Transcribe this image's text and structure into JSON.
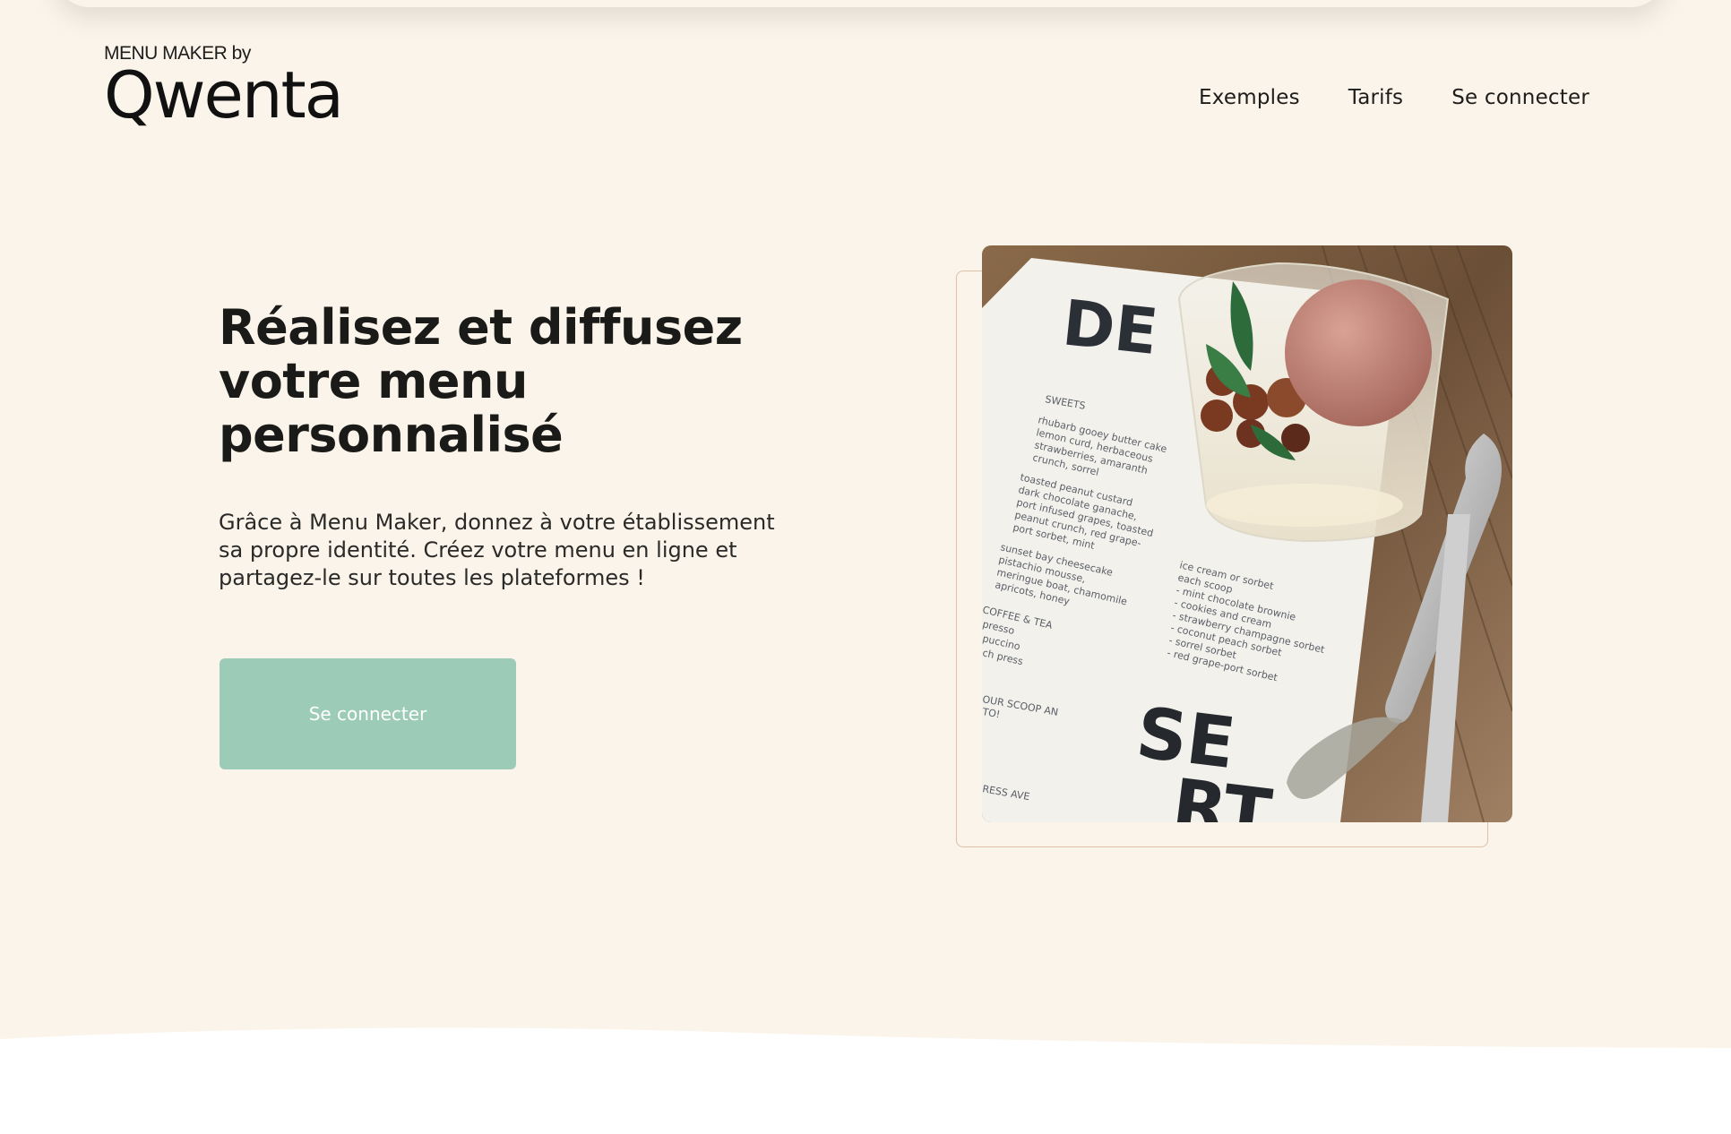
{
  "header": {
    "logo_byline": "MENU MAKER by",
    "logo_brand": "Qwenta",
    "nav": [
      {
        "label": "Exemples"
      },
      {
        "label": "Tarifs"
      },
      {
        "label": "Se connecter"
      }
    ]
  },
  "hero": {
    "title_line1": "Réalisez et diffusez",
    "title_line2": "votre menu",
    "title_line3": "personnalisé",
    "text_line1": "Grâce à Menu Maker, donnez à votre établissement",
    "text_line2": "sa propre identité. Créez votre menu en ligne et",
    "text_line3": "partagez-le sur toutes les plateformes !",
    "cta_label": "Se connecter"
  },
  "photo": {
    "menu_heading_top": "DE",
    "menu_heading_bottom_1": "SE",
    "menu_heading_bottom_2": "RT",
    "section_label": "SWEETS",
    "items": [
      "rhubarb gooey butter cake",
      "lemon curd, herbaceous",
      "strawberries, amaranth",
      "crunch, sorrel",
      "toasted peanut custard",
      "dark chocolate ganache,",
      "port infused grapes, toasted",
      "peanut crunch, red grape-",
      "port sorbet, mint",
      "sunset bay cheesecake",
      "pistachio mousse,",
      "meringue boat, chamomile",
      "apricots, honey",
      "ice cream or sorbet",
      "each scoop",
      "- mint chocolate brownie",
      "- cookies and cream",
      "- strawberry champagne sorbet",
      "- coconut peach sorbet",
      "- sorrel sorbet",
      "- red grape-port sorbet",
      "COFFEE & TEA",
      "presso",
      "puccino",
      "ch press",
      "OUR SCOOP AN",
      "TO!",
      "RESS AVE"
    ]
  },
  "colors": {
    "background": "#fbf4ea",
    "cta": "#9ccbb7",
    "frame": "#e2bfa2"
  }
}
